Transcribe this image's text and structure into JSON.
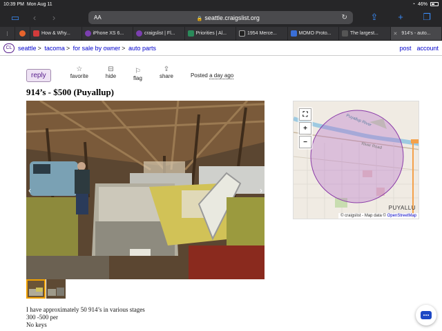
{
  "status": {
    "time": "10:39 PM",
    "date": "Mon Aug 11",
    "battery": "46%"
  },
  "toolbar": {
    "aa": "AA",
    "url": "seattle.craigslist.org"
  },
  "tabs": [
    {
      "label": "How & Why...",
      "color": "#d23b3b"
    },
    {
      "label": "iPhone XS 6...",
      "color": "#7b3fb0"
    },
    {
      "label": "craigslist | Fl...",
      "color": "#7b3fb0"
    },
    {
      "label": "Priorities | Al...",
      "color": "#2a8a5a"
    },
    {
      "label": "1954 Merce...",
      "color": "#222222"
    },
    {
      "label": "MOMO Proto...",
      "color": "#3a6fd8"
    },
    {
      "label": "The largest...",
      "color": "#555555"
    },
    {
      "label": "914's - auto...",
      "color": "#777777"
    }
  ],
  "header": {
    "logo": "CL",
    "breadcrumbs": [
      "seattle",
      "tacoma",
      "for sale by owner",
      "auto parts"
    ],
    "post": "post",
    "account": "account"
  },
  "actions": {
    "reply": "reply",
    "favorite": "favorite",
    "hide": "hide",
    "flag": "flag",
    "share": "share",
    "posted_prefix": "Posted",
    "posted_ago": "a day ago"
  },
  "listing": {
    "title": "914’s - $500 (Puyallup)",
    "description": [
      "I have approximately 50 914’s in various stages",
      "300 -500 per",
      "No keys"
    ]
  },
  "map": {
    "place": "PUYALLU",
    "attribution": "© craigslist - Map data ©",
    "osm": "OpenStreetMap",
    "river_label": "Puyallup River",
    "road_label": "River Road"
  }
}
